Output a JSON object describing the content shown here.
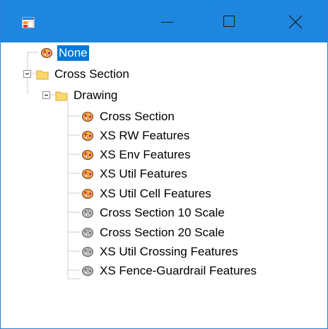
{
  "window": {
    "accent": "#1f86e0",
    "buttons": {
      "minimize": "minimize",
      "maximize": "maximize",
      "close": "close"
    }
  },
  "tree": {
    "selected_color": "#0078d7",
    "nodes": [
      {
        "label": "None",
        "icon": "palette-color-icon",
        "selected": true
      },
      {
        "label": "Cross Section",
        "icon": "folder-icon",
        "expanded": true
      },
      {
        "label": "Drawing",
        "icon": "folder-icon",
        "expanded": true
      },
      {
        "label": "Cross Section",
        "icon": "palette-color-icon"
      },
      {
        "label": "XS RW Features",
        "icon": "palette-color-icon"
      },
      {
        "label": "XS Env Features",
        "icon": "palette-color-icon"
      },
      {
        "label": "XS Util Features",
        "icon": "palette-color-icon"
      },
      {
        "label": "XS Util Cell Features",
        "icon": "palette-color-icon"
      },
      {
        "label": "Cross Section 10 Scale",
        "icon": "palette-gray-icon"
      },
      {
        "label": "Cross Section 20 Scale",
        "icon": "palette-gray-icon"
      },
      {
        "label": "XS Util Crossing Features",
        "icon": "palette-gray-icon"
      },
      {
        "label": "XS Fence-Guardrail Features",
        "icon": "palette-gray-icon"
      }
    ]
  }
}
